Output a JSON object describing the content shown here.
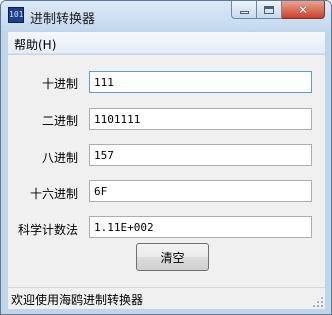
{
  "window": {
    "title": "进制转换器",
    "app_icon_text": "101"
  },
  "menu": {
    "help": "帮助(H)"
  },
  "fields": [
    {
      "label": "十进制",
      "value": "111"
    },
    {
      "label": "二进制",
      "value": "1101111"
    },
    {
      "label": "八进制",
      "value": "157"
    },
    {
      "label": "十六进制",
      "value": "6F"
    },
    {
      "label": "科学计数法",
      "value": "1.11E+002"
    }
  ],
  "buttons": {
    "clear": "清空"
  },
  "status": {
    "text": "欢迎使用海鸥进制转换器"
  },
  "icons": {
    "minimize": "minimize-icon",
    "maximize": "maximize-icon",
    "close": "close-icon"
  }
}
